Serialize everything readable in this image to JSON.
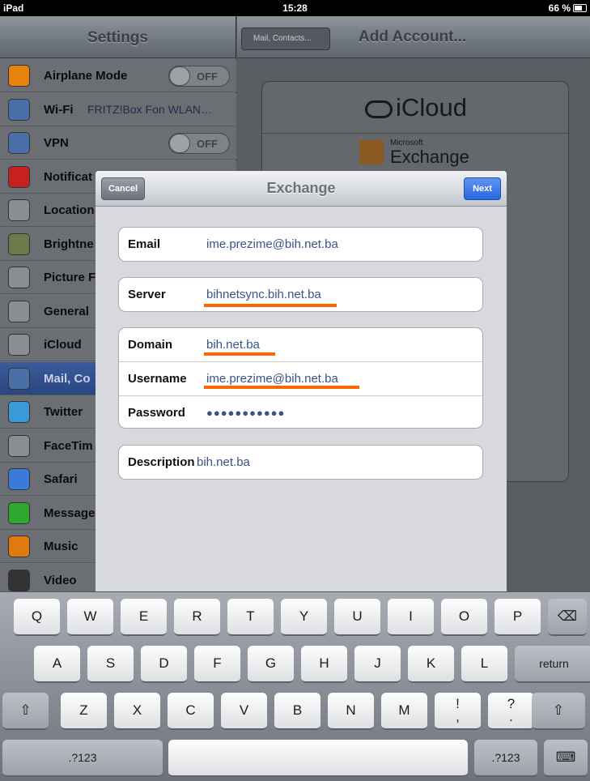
{
  "status_bar": {
    "device": "iPad",
    "time": "15:28",
    "battery": "66 %"
  },
  "sidebar": {
    "title": "Settings",
    "items": [
      {
        "label": "Airplane Mode",
        "toggle": "OFF",
        "icon": "airplane-icon",
        "color": "#e8820f"
      },
      {
        "label": "Wi-Fi",
        "detail": "FRITZ!Box Fon WLAN…",
        "icon": "wifi-icon",
        "color": "#4a6fa8"
      },
      {
        "label": "VPN",
        "toggle": "OFF",
        "icon": "vpn-icon",
        "color": "#4a6fa8"
      },
      {
        "label": "Notificat",
        "icon": "notifications-icon",
        "color": "#c62020"
      },
      {
        "label": "Location",
        "icon": "location-icon",
        "color": "#8a8d92"
      },
      {
        "label": "Brightne",
        "icon": "brightness-icon",
        "color": "#6a7a4a"
      },
      {
        "label": "Picture F",
        "icon": "picture-frame-icon",
        "color": "#8a8d92"
      },
      {
        "label": "General",
        "icon": "gear-icon",
        "color": "#8a8d92"
      },
      {
        "label": "iCloud",
        "icon": "icloud-icon",
        "color": "#8a8d92"
      },
      {
        "label": "Mail, Co",
        "icon": "mail-icon",
        "color": "#4a6fa8",
        "selected": true
      },
      {
        "label": "Twitter",
        "icon": "twitter-icon",
        "color": "#3a9ad8"
      },
      {
        "label": "FaceTim",
        "icon": "facetime-icon",
        "color": "#8a8d92"
      },
      {
        "label": "Safari",
        "icon": "safari-icon",
        "color": "#3a7ad8"
      },
      {
        "label": "Message",
        "icon": "messages-icon",
        "color": "#2fa82f"
      },
      {
        "label": "Music",
        "icon": "music-icon",
        "color": "#e07a10"
      },
      {
        "label": "Video",
        "icon": "video-icon",
        "color": "#333333"
      }
    ]
  },
  "right_pane": {
    "back_label": "Mail, Contacts...",
    "title": "Add Account...",
    "accounts": {
      "icloud": "iCloud",
      "exchange_brand": "Microsoft",
      "exchange": "Exchange"
    }
  },
  "modal": {
    "title": "Exchange",
    "cancel_label": "Cancel",
    "next_label": "Next",
    "fields": {
      "email": {
        "label": "Email",
        "value": "ime.prezime@bih.net.ba"
      },
      "server": {
        "label": "Server",
        "value": "bihnetsync.bih.net.ba"
      },
      "domain": {
        "label": "Domain",
        "value": "bih.net.ba"
      },
      "username": {
        "label": "Username",
        "value": "ime.prezime@bih.net.ba"
      },
      "password": {
        "label": "Password",
        "value": "●●●●●●●●●●●"
      },
      "description": {
        "label": "Description",
        "value": "bih.net.ba"
      }
    },
    "highlight_color": "#ff6600"
  },
  "keyboard": {
    "row1": [
      "Q",
      "W",
      "E",
      "R",
      "T",
      "Y",
      "U",
      "I",
      "O",
      "P"
    ],
    "row2": [
      "A",
      "S",
      "D",
      "F",
      "G",
      "H",
      "J",
      "K",
      "L"
    ],
    "row3": [
      "Z",
      "X",
      "C",
      "V",
      "B",
      "N",
      "M"
    ],
    "return_label": "return",
    "num_label": ".?123",
    "punct": [
      {
        "top": "!",
        "bottom": ","
      },
      {
        "top": "?",
        "bottom": "."
      }
    ]
  }
}
